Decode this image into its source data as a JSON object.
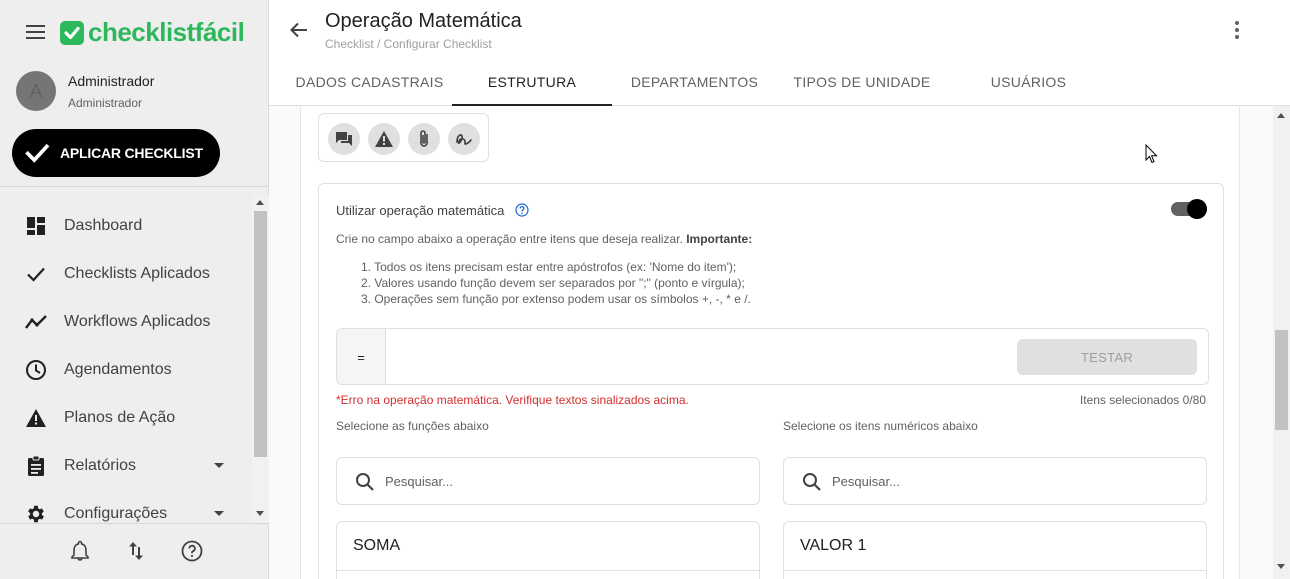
{
  "sidebar": {
    "logo": "checklistfácil",
    "user": {
      "initial": "A",
      "name": "Administrador",
      "role": "Administrador"
    },
    "apply_label": "APLICAR CHECKLIST",
    "items": [
      {
        "label": "Dashboard",
        "icon": "dashboard-icon"
      },
      {
        "label": "Checklists Aplicados",
        "icon": "check-icon"
      },
      {
        "label": "Workflows Aplicados",
        "icon": "trending-icon"
      },
      {
        "label": "Agendamentos",
        "icon": "clock-icon"
      },
      {
        "label": "Planos de Ação",
        "icon": "warning-icon"
      },
      {
        "label": "Relatórios",
        "icon": "clipboard-icon"
      },
      {
        "label": "Configurações",
        "icon": "gear-icon"
      }
    ]
  },
  "header": {
    "title": "Operação Matemática",
    "breadcrumb": "Checklist / Configurar Checklist",
    "tabs": [
      "DADOS CADASTRAIS",
      "ESTRUTURA",
      "DEPARTAMENTOS",
      "TIPOS DE UNIDADE",
      "USUÁRIOS"
    ],
    "active_tab": "ESTRUTURA"
  },
  "math": {
    "label": "Utilizar operação matemática",
    "enabled": true,
    "description": "Crie no campo abaixo a operação entre itens que deseja realizar. ",
    "description_bold": "Importante:",
    "rules": [
      "1. Todos os itens precisam estar entre apóstrofos (ex: 'Nome do item');",
      "2. Valores usando função devem ser separados por \";\" (ponto e vírgula);",
      "3. Operações sem função por extenso podem usar os símbolos +, -, * e /."
    ],
    "equals": "=",
    "formula_value": "",
    "test_label": "TESTAR",
    "error": "*Erro na operação matemática. Verifique textos sinalizados acima.",
    "selected_count": "Itens selecionados 0/80",
    "functions_label": "Selecione as funções abaixo",
    "items_label": "Selecione os itens numéricos abaixo",
    "search_placeholder": "Pesquisar...",
    "functions": [
      "SOMA"
    ],
    "numeric_items": [
      "VALOR 1"
    ]
  },
  "colors": {
    "brand": "#2eb85c",
    "error": "#d32f2f"
  }
}
